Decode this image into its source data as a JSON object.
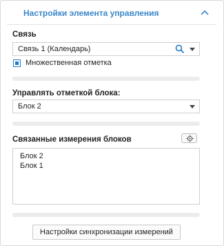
{
  "header": {
    "title": "Настройки элемента управления",
    "collapse_icon": "chevron-up-icon"
  },
  "link": {
    "label": "Связь",
    "value": "Связь 1 (Календарь)",
    "multi_select_label": "Множественная отметка",
    "multi_select_checked": true
  },
  "block_mark": {
    "label": "Управлять отметкой блока:",
    "value": "Блок 2"
  },
  "linked_dimensions": {
    "label": "Связанные измерения блоков",
    "items": [
      "Блок 2",
      "Блок 1"
    ]
  },
  "footer": {
    "sync_button_label": "Настройки синхронизации измерений"
  },
  "colors": {
    "accent": "#3a86c8",
    "checkbox": "#1f7bc6",
    "separator": "#ececec"
  }
}
